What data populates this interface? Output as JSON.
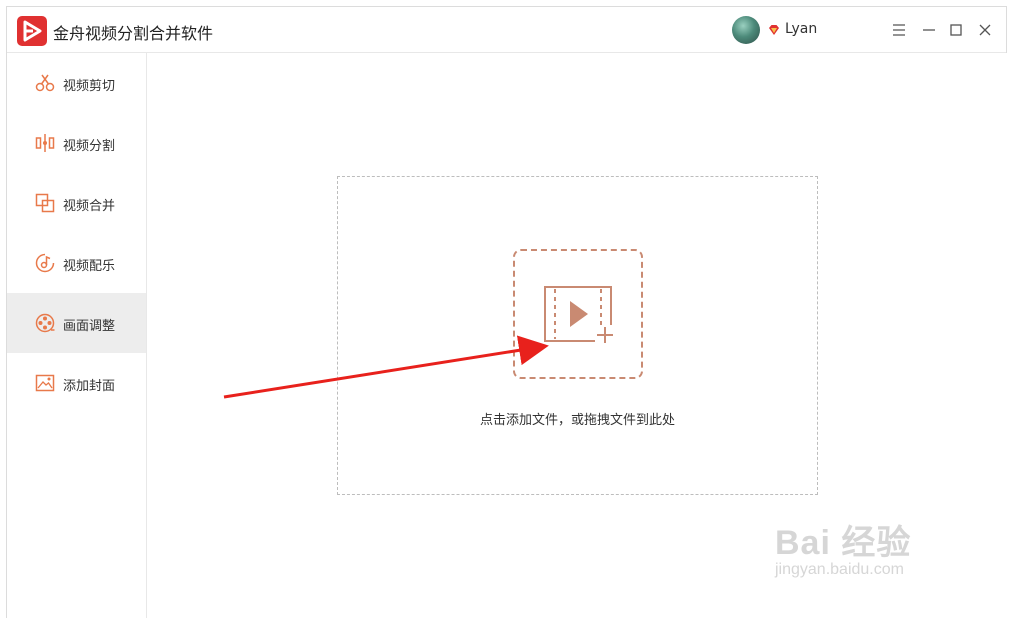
{
  "app": {
    "title": "金舟视频分割合并软件"
  },
  "user": {
    "name": "Lyan"
  },
  "sidebar": {
    "items": [
      {
        "label": "视频剪切",
        "icon": "scissors-icon",
        "active": false
      },
      {
        "label": "视频分割",
        "icon": "split-icon",
        "active": false
      },
      {
        "label": "视频合并",
        "icon": "merge-icon",
        "active": false
      },
      {
        "label": "视频配乐",
        "icon": "music-disc-icon",
        "active": false
      },
      {
        "label": "画面调整",
        "icon": "film-reel-icon",
        "active": true
      },
      {
        "label": "添加封面",
        "icon": "image-icon",
        "active": false
      }
    ]
  },
  "main": {
    "dropzone_hint": "点击添加文件，或拖拽文件到此处"
  },
  "watermark": {
    "main": "Bai 经验",
    "sub": "jingyan.baidu.com"
  },
  "colors": {
    "accent": "#e8794a",
    "brand_red": "#e03131",
    "drop_border": "#c98a72",
    "active_bg": "#ededed",
    "arrow": "#e8211c"
  }
}
